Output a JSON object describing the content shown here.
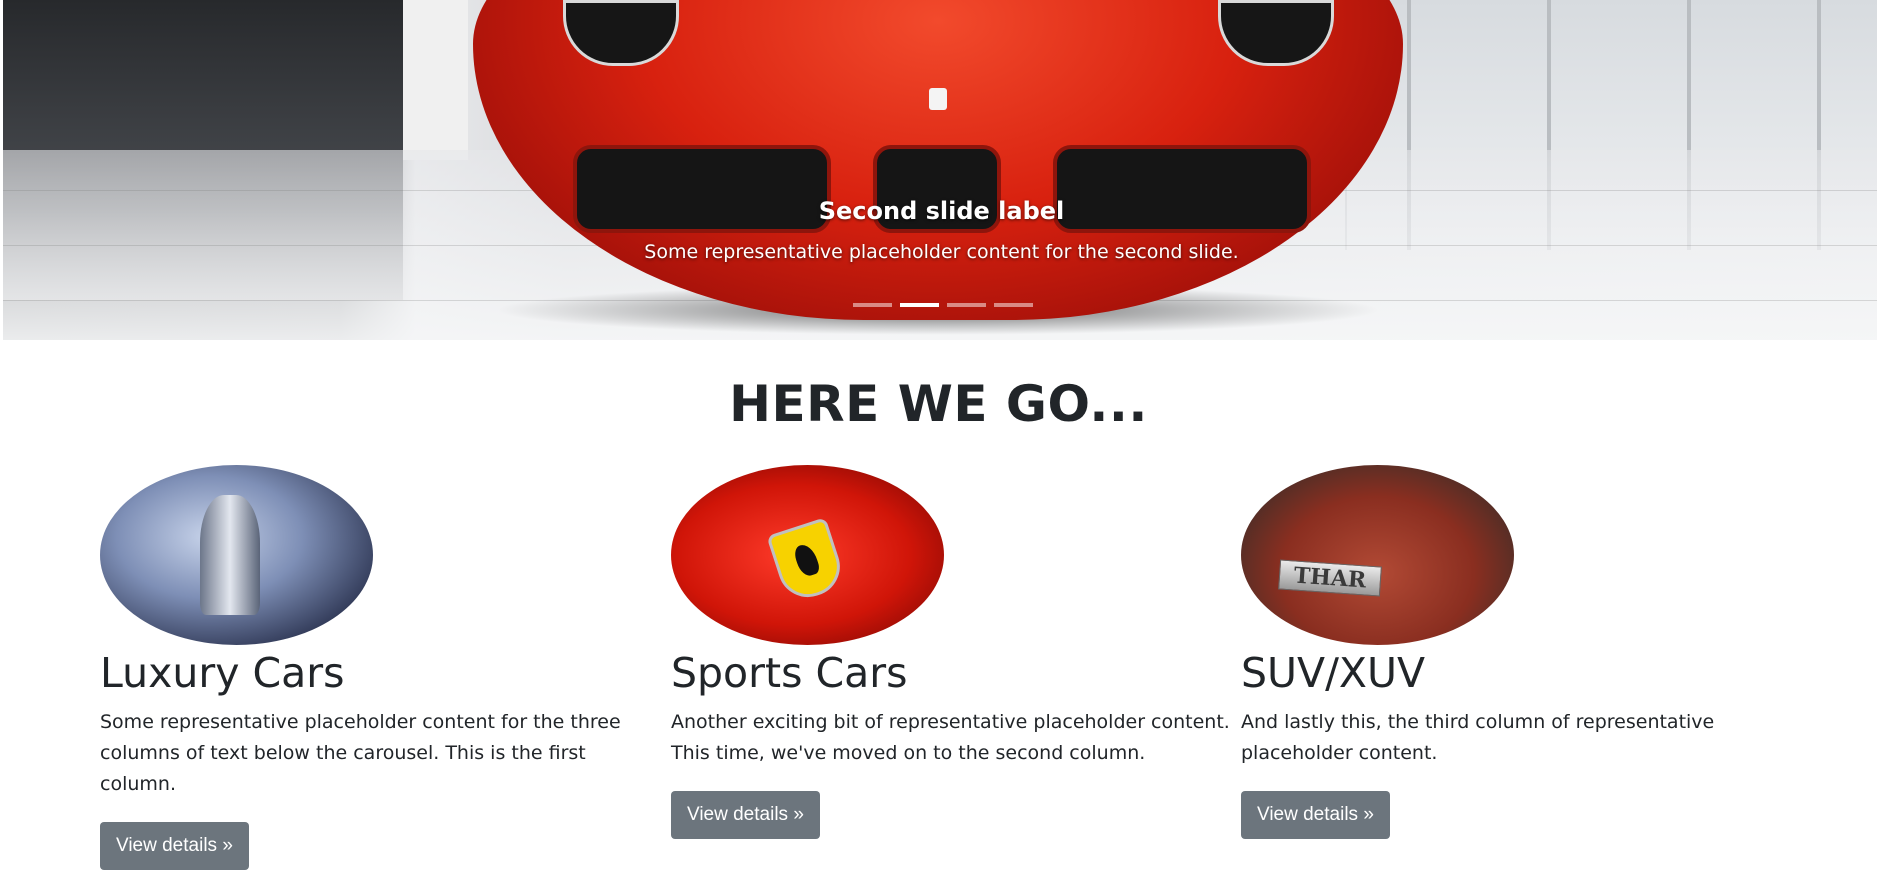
{
  "carousel": {
    "active_index": 1,
    "slide_title": "Second slide label",
    "slide_text": "Some representative placeholder content for the second slide.",
    "indicator_count": 4
  },
  "section": {
    "heading": "HERE WE GO..."
  },
  "columns": [
    {
      "title": "Luxury Cars",
      "text": "Some representative placeholder content for the three columns of text below the carousel. This is the first column.",
      "button": "View details »"
    },
    {
      "title": "Sports Cars",
      "text": "Another exciting bit of representative placeholder content. This time, we've moved on to the second column.",
      "button": "View details »"
    },
    {
      "title": "SUV/XUV",
      "text": "And lastly this, the third column of representative placeholder content.",
      "button": "View details »",
      "badge_text": "THAR"
    }
  ],
  "colors": {
    "button_bg": "#6c757d",
    "text": "#212529",
    "car_red": "#d8210f"
  }
}
